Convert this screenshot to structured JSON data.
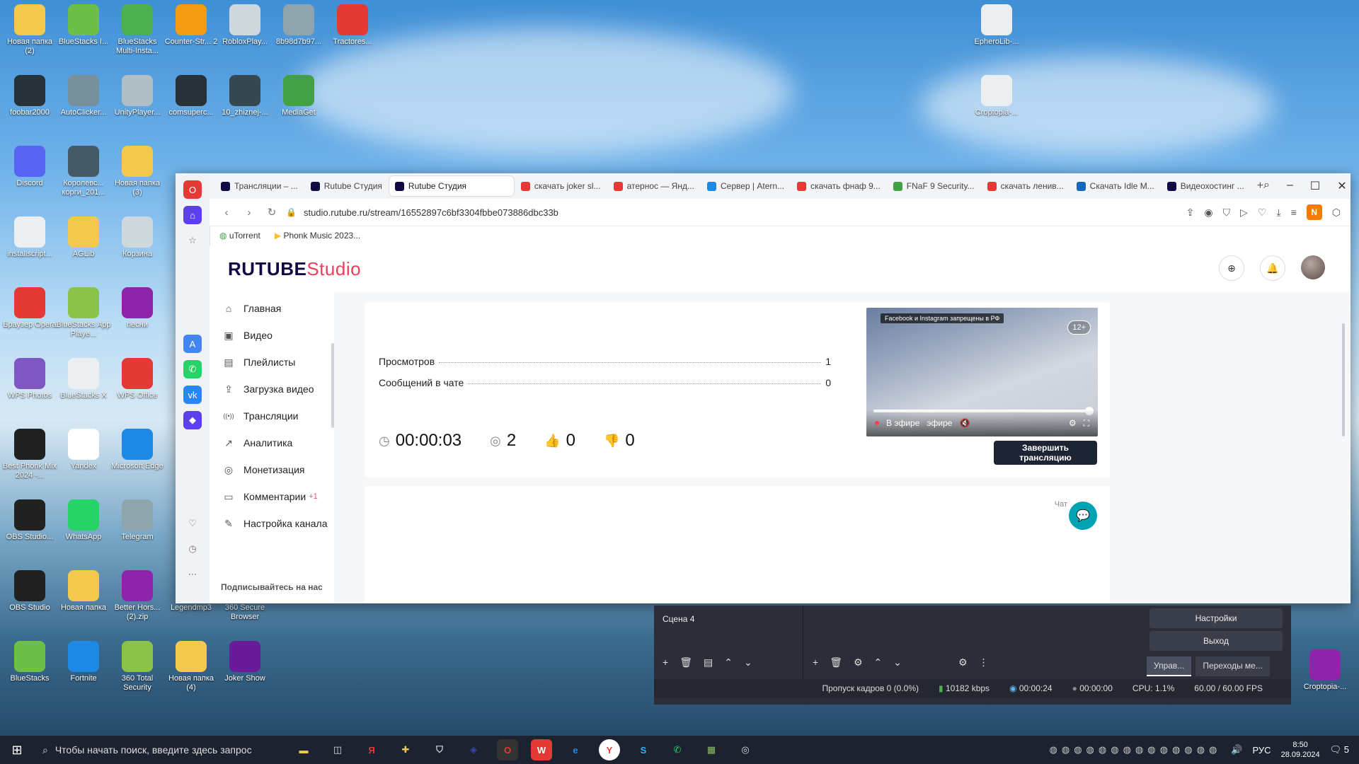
{
  "desktop": {
    "icons": [
      {
        "label": "Новая папка (2)",
        "icon": "folder-icon",
        "color": "#f2c94c"
      },
      {
        "label": "BlueStacks I...",
        "icon": "bluestacks-icon",
        "color": "#6cc04a"
      },
      {
        "label": "BlueStacks Multi-Insta...",
        "icon": "bluestacks-multi-icon",
        "color": "#4caf50"
      },
      {
        "label": "Counter-Str... 2",
        "icon": "cs2-icon",
        "color": "#f39c12"
      },
      {
        "label": "RobloxPlay...",
        "icon": "roblox-icon",
        "color": "#cfd8dc"
      },
      {
        "label": "8b98d7b97...",
        "icon": "image-file-icon",
        "color": "#90a4ae"
      },
      {
        "label": "Tractores...",
        "icon": "wps-icon",
        "color": "#e53935"
      },
      {
        "label": "foobar2000",
        "icon": "foobar-icon",
        "color": "#263238"
      },
      {
        "label": "AutoClicker...",
        "icon": "mouse-icon",
        "color": "#78909c"
      },
      {
        "label": "UnityPlayer...",
        "icon": "gear-file-icon",
        "color": "#b0bec5"
      },
      {
        "label": "comsuperc...",
        "icon": "foobar-icon",
        "color": "#263238"
      },
      {
        "label": "10_zhiznej-...",
        "icon": "video-file-icon",
        "color": "#37474f"
      },
      {
        "label": "MediaGet",
        "icon": "mediaget-icon",
        "color": "#43a047"
      },
      {
        "label": "Discord",
        "icon": "discord-icon",
        "color": "#5865f2"
      },
      {
        "label": "Королевс... корги_201...",
        "icon": "video-file-icon",
        "color": "#455a64"
      },
      {
        "label": "Новая папка (3)",
        "icon": "folder-icon",
        "color": "#f2c94c"
      },
      {
        "label": "installscript...",
        "icon": "file-icon",
        "color": "#eceff1"
      },
      {
        "label": "AGLib",
        "icon": "folder-icon",
        "color": "#f2c94c"
      },
      {
        "label": "Корзина",
        "icon": "recycle-bin-icon",
        "color": "#cfd8dc"
      },
      {
        "label": "Браузер Opera",
        "icon": "opera-icon",
        "color": "#e53935"
      },
      {
        "label": "BlueStacks App Playe...",
        "icon": "bluestacks-icon",
        "color": "#8bc34a"
      },
      {
        "label": "песни",
        "icon": "archive-icon",
        "color": "#8e24aa"
      },
      {
        "label": "WPS Photos",
        "icon": "wps-photos-icon",
        "color": "#7e57c2"
      },
      {
        "label": "BlueStacks X",
        "icon": "file-icon",
        "color": "#eceff1"
      },
      {
        "label": "WPS Office",
        "icon": "wps-icon",
        "color": "#e53935"
      },
      {
        "label": "Best Phonk Mix 2024 -...",
        "icon": "mp3-icon",
        "color": "#212121"
      },
      {
        "label": "Yandex",
        "icon": "yandex-icon",
        "color": "#ffffff"
      },
      {
        "label": "Microsoft Edge",
        "icon": "edge-icon",
        "color": "#1e88e5"
      },
      {
        "label": "OBS Studio...",
        "icon": "obs-icon",
        "color": "#212121"
      },
      {
        "label": "WhatsApp",
        "icon": "whatsapp-icon",
        "color": "#25d366"
      },
      {
        "label": "Telegram",
        "icon": "telegram-icon",
        "color": "#90a4ae"
      },
      {
        "label": "OBS Studio",
        "icon": "obs-icon",
        "color": "#212121"
      },
      {
        "label": "Новая папка",
        "icon": "folder-icon",
        "color": "#f2c94c"
      },
      {
        "label": "Better Hors... (2).zip",
        "icon": "archive-icon",
        "color": "#8e24aa"
      },
      {
        "label": "Legendmp3",
        "icon": "legendmp3-icon",
        "color": "#37474f"
      },
      {
        "label": "360 Secure Browser",
        "icon": "browser-icon",
        "color": "#90a4ae"
      },
      {
        "label": "BlueStacks",
        "icon": "bluestacks-icon",
        "color": "#6cc04a"
      },
      {
        "label": "Fortnite",
        "icon": "fortnite-icon",
        "color": "#1e88e5"
      },
      {
        "label": "360 Total Security",
        "icon": "360-security-icon",
        "color": "#8bc34a"
      },
      {
        "label": "Новая папка (4)",
        "icon": "folder-icon",
        "color": "#f2c94c"
      },
      {
        "label": "Joker Show",
        "icon": "joker-icon",
        "color": "#6a1b9a"
      },
      {
        "label": "EpheroLib-...",
        "icon": "java-icon",
        "color": "#eceff1"
      },
      {
        "label": "Croptopia-...",
        "icon": "java-icon",
        "color": "#eceff1"
      },
      {
        "label": "Croptopia-...",
        "icon": "archive-icon",
        "color": "#8e24aa"
      }
    ]
  },
  "browser": {
    "tabs": [
      {
        "label": "Трансляции – ...",
        "favicon_color": "#100943"
      },
      {
        "label": "Rutube Студия",
        "favicon_color": "#100943"
      },
      {
        "label": "Rutube Студия",
        "favicon_color": "#100943",
        "active": true
      },
      {
        "label": "скачать joker sl...",
        "favicon_color": "#e53935"
      },
      {
        "label": "атернос — Янд...",
        "favicon_color": "#e53935"
      },
      {
        "label": "Сервер | Atern...",
        "favicon_color": "#1e88e5"
      },
      {
        "label": "скачать фнаф 9...",
        "favicon_color": "#e53935"
      },
      {
        "label": "FNaF 9 Security...",
        "favicon_color": "#43a047"
      },
      {
        "label": "скачать ленив...",
        "favicon_color": "#e53935"
      },
      {
        "label": "Скачать Idle M...",
        "favicon_color": "#1565c0"
      },
      {
        "label": "Видеохостинг ...",
        "favicon_color": "#100943"
      }
    ],
    "url": "studio.rutube.ru/stream/16552897c6bf3304fbbe073886dbc33b",
    "bookmarks": [
      {
        "label": "uTorrent",
        "icon": "utorrent-icon"
      },
      {
        "label": "Phonk Music 2023...",
        "icon": "play-icon"
      }
    ],
    "profile_letter": "N"
  },
  "rutube": {
    "logo_main": "RUTUBE",
    "logo_sub": "Studio",
    "nav": [
      {
        "label": "Главная",
        "icon": "home-icon"
      },
      {
        "label": "Видео",
        "icon": "video-icon"
      },
      {
        "label": "Плейлисты",
        "icon": "playlist-icon"
      },
      {
        "label": "Загрузка видео",
        "icon": "upload-icon"
      },
      {
        "label": "Трансляции",
        "icon": "broadcast-icon"
      },
      {
        "label": "Аналитика",
        "icon": "chart-icon"
      },
      {
        "label": "Монетизация",
        "icon": "coin-icon"
      },
      {
        "label": "Комментарии",
        "icon": "comment-icon",
        "badge": "+1"
      },
      {
        "label": "Настройка канала",
        "icon": "wand-icon"
      }
    ],
    "subscribe_label": "Подписывайтесь на нас",
    "stats": [
      {
        "label": "Просмотров",
        "value": "1"
      },
      {
        "label": "Сообщений в чате",
        "value": "0"
      }
    ],
    "counters": {
      "duration": "00:00:03",
      "viewers": "2",
      "likes": "0",
      "dislikes": "0"
    },
    "player": {
      "warning": "Facebook и Instagram запрещены в РФ",
      "age": "12+",
      "live_label": "В эфире",
      "live_overlay": "эфире",
      "progress": 1.0
    },
    "end_button": "Завершить трансляцию",
    "chat_label": "Чат"
  },
  "obs": {
    "scene": "Сцена 4",
    "buttons": [
      "Настройки",
      "Выход"
    ],
    "tabs": [
      "Управ...",
      "Переходы ме..."
    ],
    "status": {
      "dropped": "Пропуск кадров 0 (0.0%)",
      "bitrate": "10182 kbps",
      "stream_time": "00:00:24",
      "rec_time": "00:00:00",
      "cpu": "CPU: 1.1%",
      "fps": "60.00 / 60.00 FPS"
    }
  },
  "taskbar": {
    "search_placeholder": "Чтобы начать поиск, введите здесь запрос",
    "lang": "РУС",
    "time": "8:50",
    "date": "28.09.2024",
    "notifications": "5"
  }
}
